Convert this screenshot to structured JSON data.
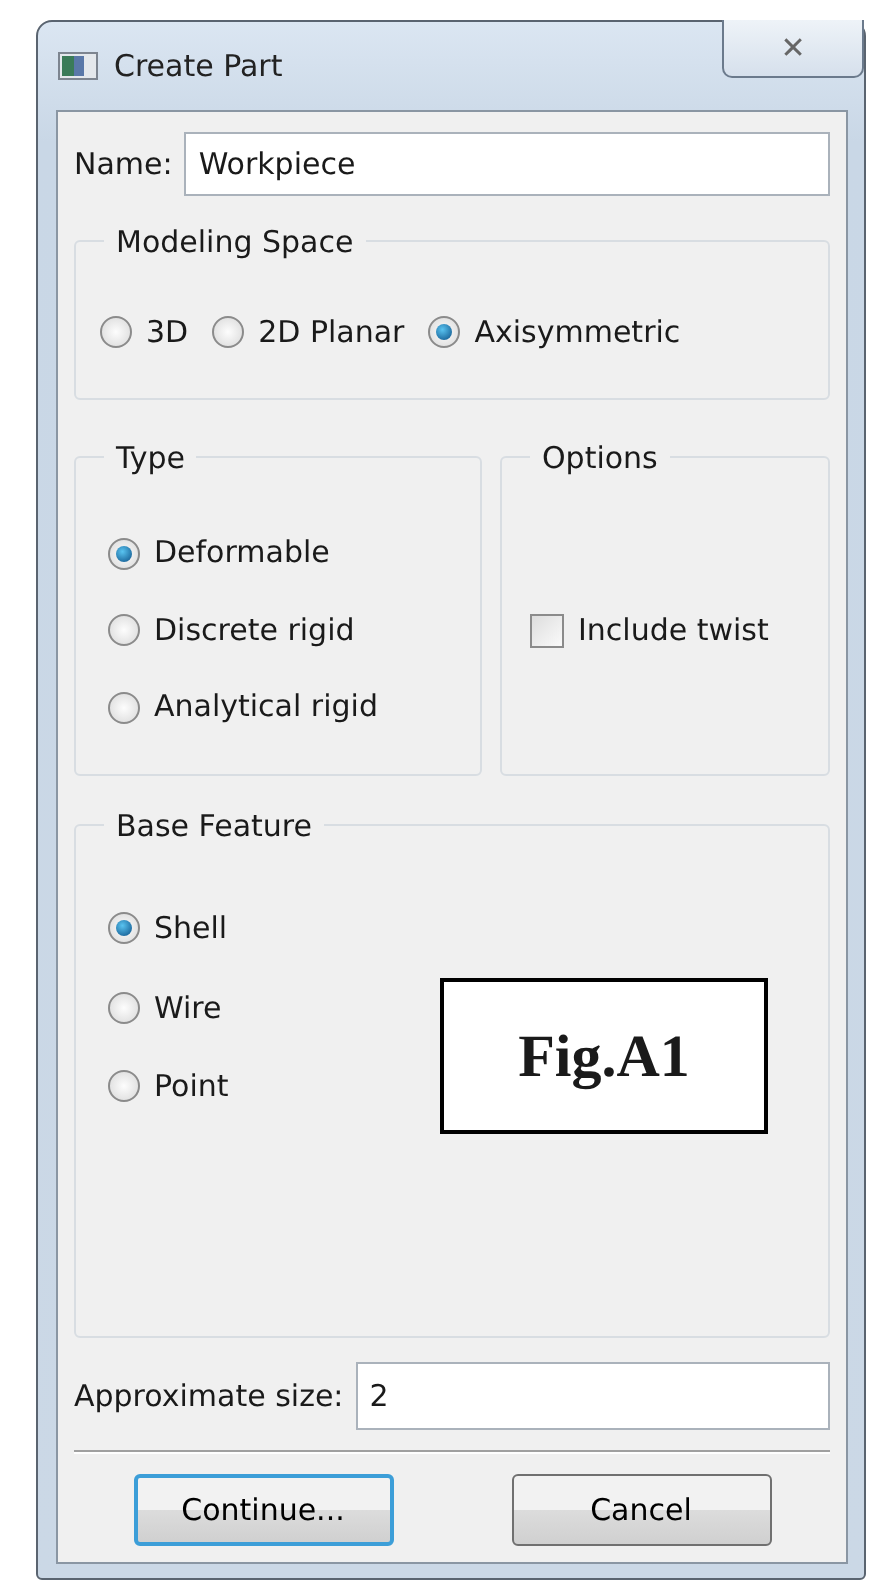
{
  "window": {
    "title": "Create Part",
    "close": "✕"
  },
  "name_field": {
    "label": "Name:",
    "value": "Workpiece"
  },
  "modeling_space": {
    "title": "Modeling Space",
    "options": [
      {
        "label": "3D",
        "selected": false
      },
      {
        "label": "2D Planar",
        "selected": false
      },
      {
        "label": "Axisymmetric",
        "selected": true
      }
    ]
  },
  "type": {
    "title": "Type",
    "options": [
      {
        "label": "Deformable",
        "selected": true
      },
      {
        "label": "Discrete rigid",
        "selected": false
      },
      {
        "label": "Analytical rigid",
        "selected": false
      }
    ]
  },
  "options": {
    "title": "Options",
    "items": [
      {
        "label": "Include twist",
        "checked": false
      }
    ]
  },
  "base_feature": {
    "title": "Base Feature",
    "options": [
      {
        "label": "Shell",
        "selected": true
      },
      {
        "label": "Wire",
        "selected": false
      },
      {
        "label": "Point",
        "selected": false
      }
    ]
  },
  "figure_label": "Fig.A1",
  "approximate_size": {
    "label": "Approximate size:",
    "value": "2"
  },
  "buttons": [
    {
      "label": "Continue...",
      "default": true
    },
    {
      "label": "Cancel",
      "default": false
    }
  ]
}
